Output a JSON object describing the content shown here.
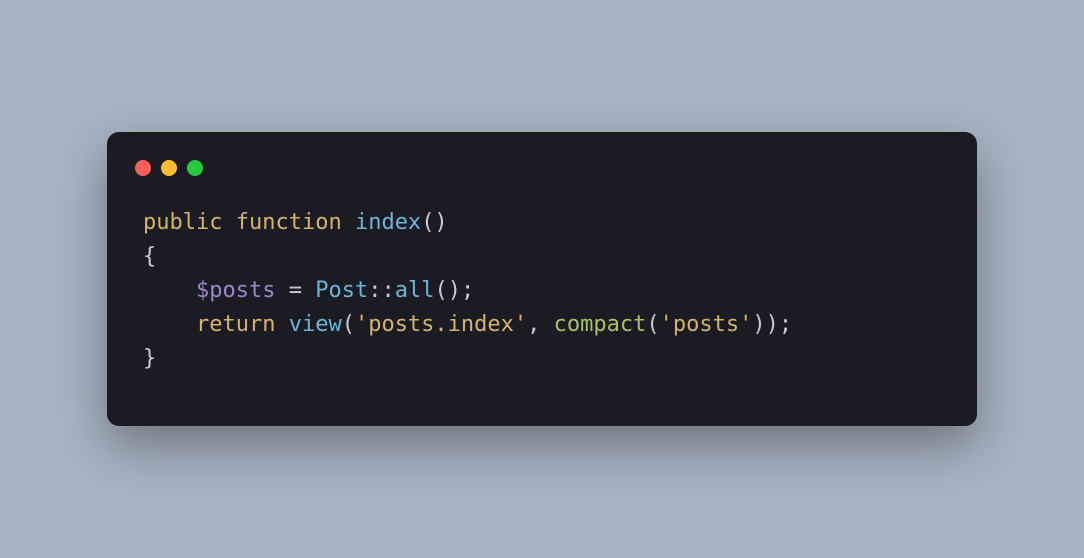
{
  "window": {
    "controls": {
      "red_color": "#ff5f56",
      "yellow_color": "#ffbd2e",
      "green_color": "#27c93f"
    }
  },
  "code": {
    "line1": {
      "kw_public": "public",
      "kw_function": "function",
      "func_name": "index",
      "parens": "()"
    },
    "line2": {
      "brace_open": "{"
    },
    "line3": {
      "indent": "    ",
      "var": "$posts",
      "eq": " = ",
      "class": "Post",
      "scope": "::",
      "method": "all",
      "call_end": "();"
    },
    "line4": {
      "indent": "    ",
      "kw_return": "return",
      "sp": " ",
      "view_call": "view",
      "open_paren": "(",
      "str1": "'posts.index'",
      "comma": ", ",
      "compact_call": "compact",
      "open_paren2": "(",
      "str2": "'posts'",
      "close": "));"
    },
    "line5": {
      "brace_close": "}"
    }
  }
}
